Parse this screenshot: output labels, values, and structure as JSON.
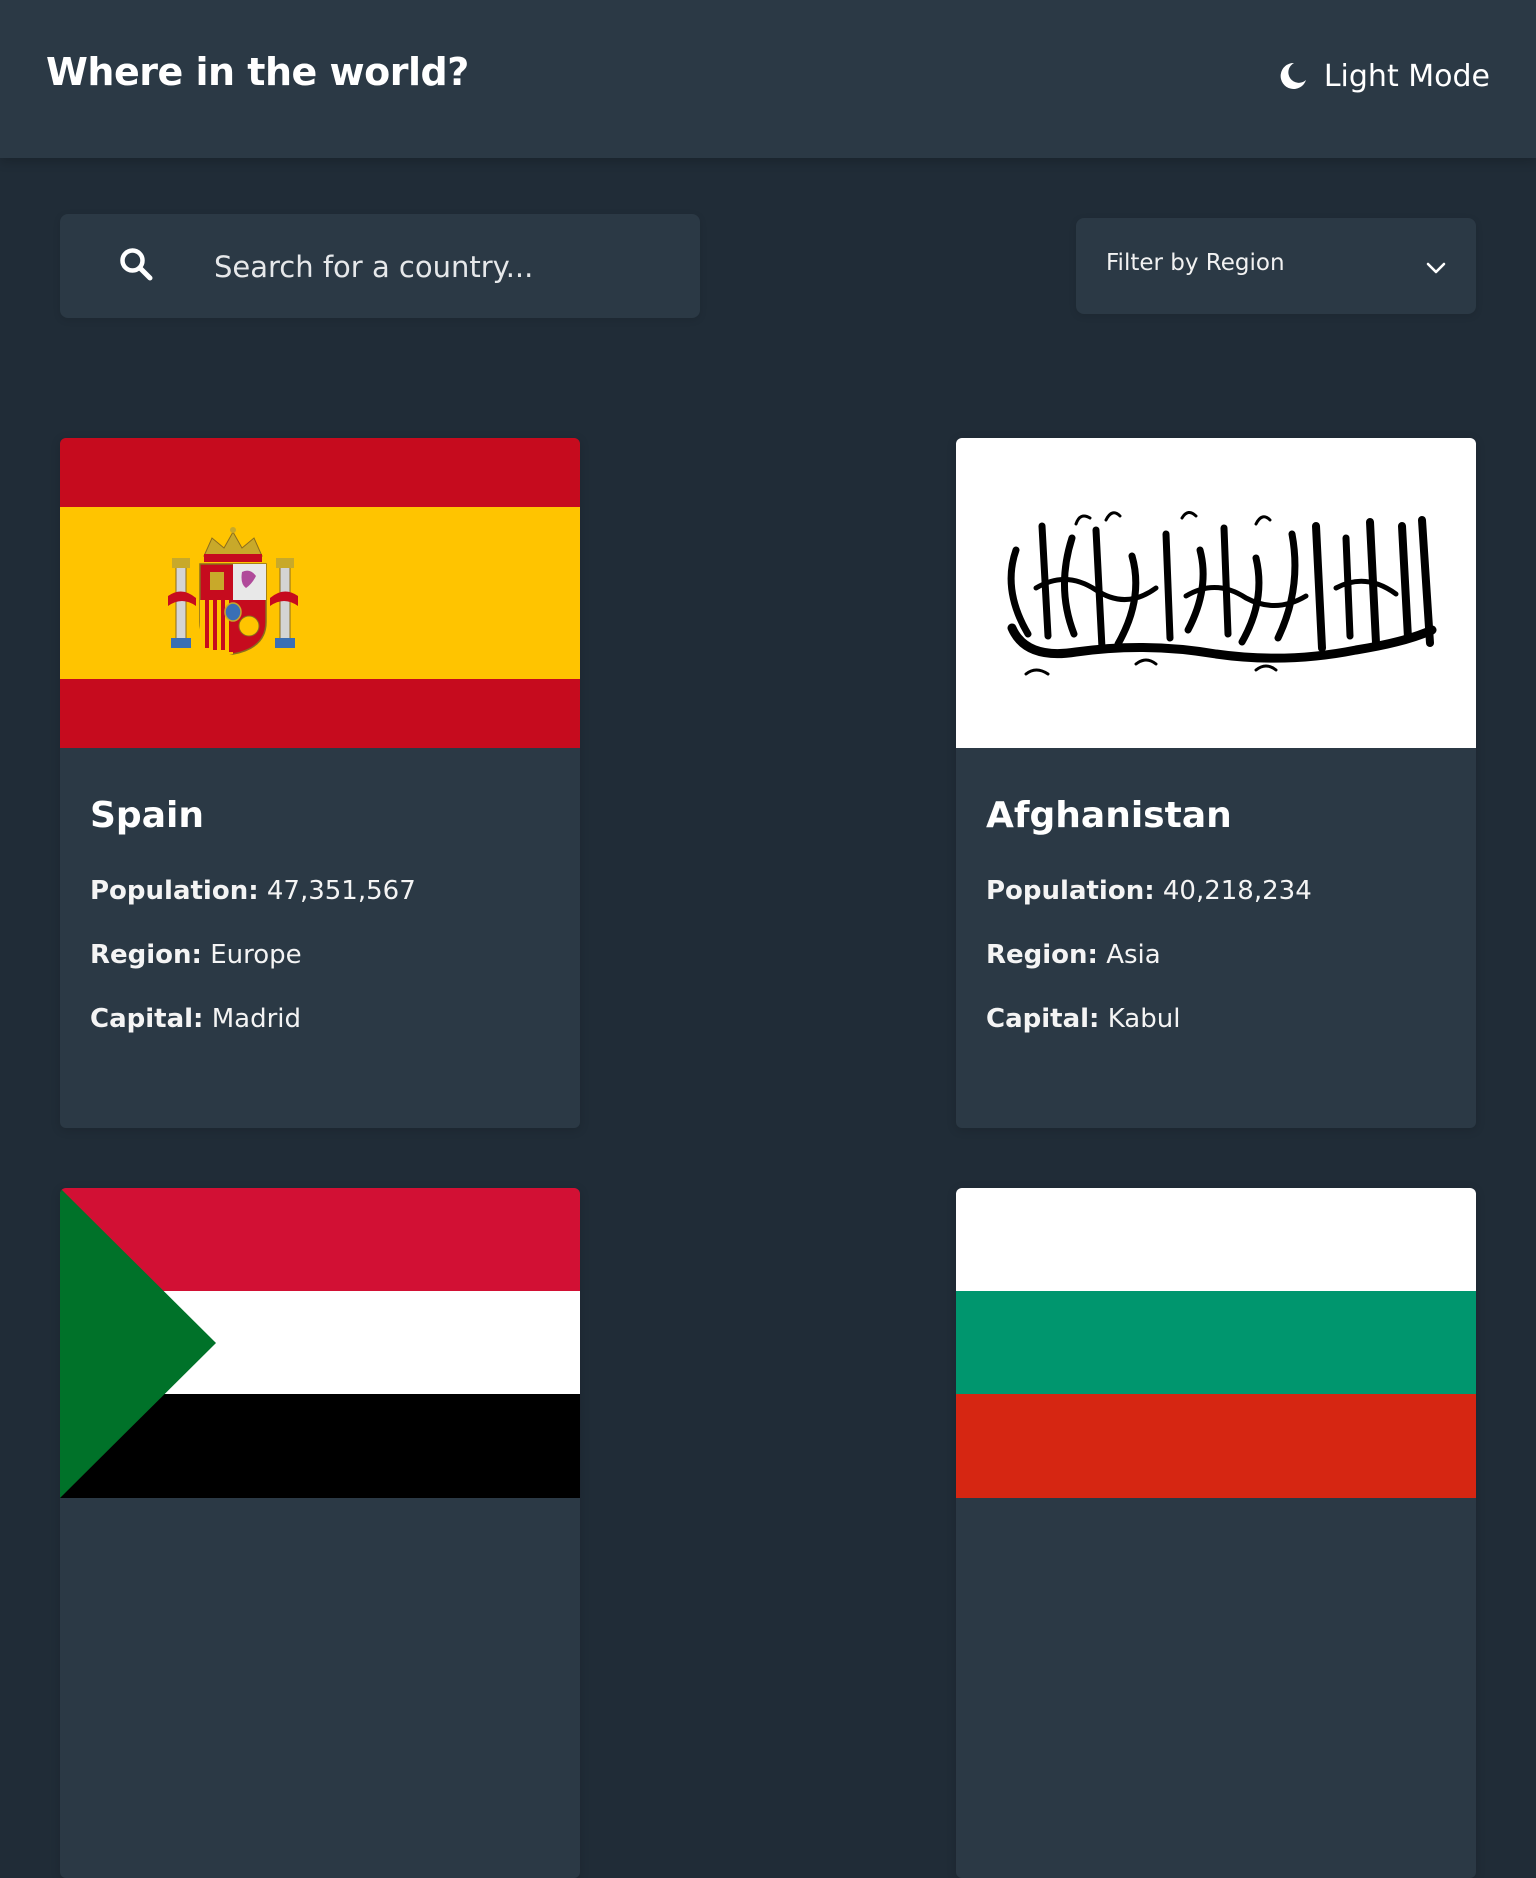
{
  "header": {
    "title": "Where in the world?",
    "mode_toggle": {
      "label": "Light Mode",
      "icon": "moon-icon"
    }
  },
  "search": {
    "placeholder": "Search for a country...",
    "value": "",
    "icon": "search-icon"
  },
  "filter": {
    "label": "Filter by Region",
    "icon": "chevron-down-icon"
  },
  "labels": {
    "population": "Population:",
    "region": "Region:",
    "capital": "Capital:"
  },
  "countries": [
    {
      "name": "Spain",
      "population": "47,351,567",
      "region": "Europe",
      "capital": "Madrid"
    },
    {
      "name": "Afghanistan",
      "population": "40,218,234",
      "region": "Asia",
      "capital": "Kabul"
    },
    {
      "name": "",
      "population": "",
      "region": "",
      "capital": ""
    },
    {
      "name": "",
      "population": "",
      "region": "",
      "capital": ""
    }
  ],
  "colors": {
    "background": "#202c37",
    "element": "#2b3945",
    "text": "#ffffff"
  }
}
